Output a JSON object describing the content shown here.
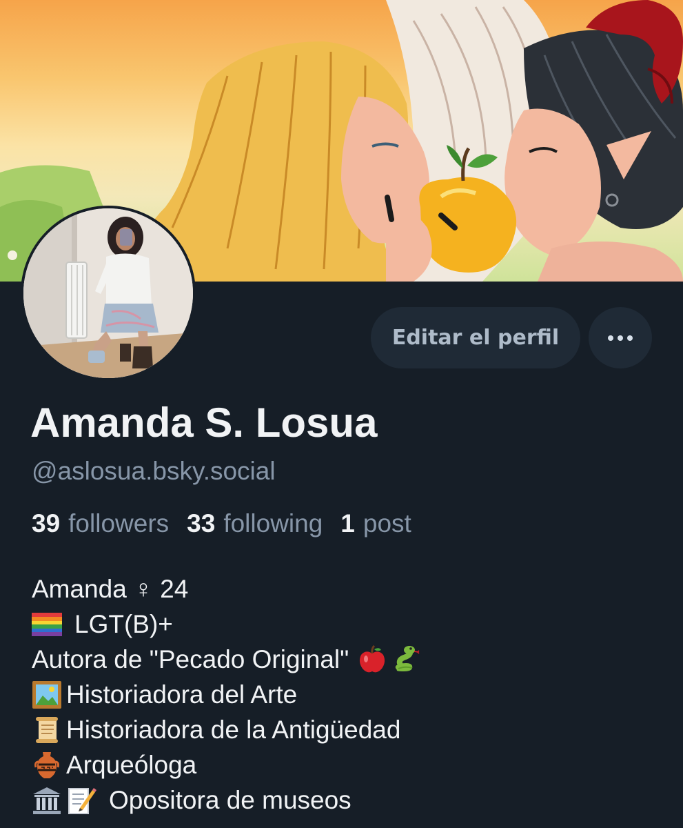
{
  "profile": {
    "display_name": "Amanda S. Losua",
    "handle": "@aslosua.bsky.social"
  },
  "actions": {
    "edit_label": "Editar el perfil",
    "more_icon": "ellipsis-icon"
  },
  "stats": {
    "followers_count": "39",
    "followers_label": "followers",
    "following_count": "33",
    "following_label": "following",
    "posts_count": "1",
    "posts_label": "post"
  },
  "bio": {
    "line1": "Amanda ♀ 24",
    "line2": "LGT(B)+",
    "line3": "Autora de \"Pecado Original\"",
    "line4": "Historiadora del Arte",
    "line5": "Historiadora de la Antigüedad",
    "line6": "Arqueóloga",
    "line7": "Opositora de museos"
  },
  "icons": {
    "line2": "rainbow-flag-icon",
    "line3": [
      "apple-icon",
      "snake-icon"
    ],
    "line4": "framed-picture-icon",
    "line5": "scroll-icon",
    "line6": "amphora-icon",
    "line7": [
      "classical-building-icon",
      "memo-icon"
    ]
  },
  "colors": {
    "background": "#161e27",
    "button_bg": "#1f2a36",
    "primary_text": "#f1f3f5",
    "secondary_text": "#8796a8",
    "button_text": "#aebbc9"
  }
}
